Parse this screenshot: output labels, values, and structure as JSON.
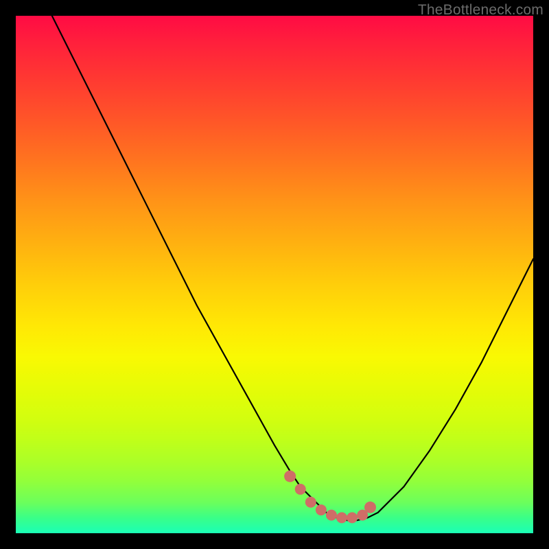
{
  "watermark": "TheBottleneck.com",
  "colors": {
    "background": "#000000",
    "curve": "#000000",
    "markers": "#cf6d67",
    "watermark_text": "#6b6b6b"
  },
  "chart_data": {
    "type": "line",
    "title": "",
    "xlabel": "",
    "ylabel": "",
    "xlim": [
      0,
      100
    ],
    "ylim": [
      0,
      100
    ],
    "x": [
      7,
      10,
      15,
      20,
      25,
      30,
      35,
      40,
      45,
      50,
      53,
      55,
      58,
      60,
      62,
      64,
      66,
      68,
      70,
      75,
      80,
      85,
      90,
      95,
      100
    ],
    "values": [
      100,
      94,
      84,
      74,
      64,
      54,
      44,
      35,
      26,
      17,
      12,
      9,
      6,
      4,
      3,
      2.5,
      2.5,
      3,
      4,
      9,
      16,
      24,
      33,
      43,
      53
    ],
    "markers": {
      "x": [
        53,
        55,
        57,
        59,
        61,
        63,
        65,
        67,
        68.5
      ],
      "values": [
        11,
        8.5,
        6,
        4.5,
        3.5,
        3,
        3,
        3.5,
        5
      ]
    },
    "gradient_stops": [
      {
        "pos": 0,
        "color": "#ff0b44"
      },
      {
        "pos": 50,
        "color": "#ffd808"
      },
      {
        "pos": 100,
        "color": "#1affb6"
      }
    ]
  }
}
